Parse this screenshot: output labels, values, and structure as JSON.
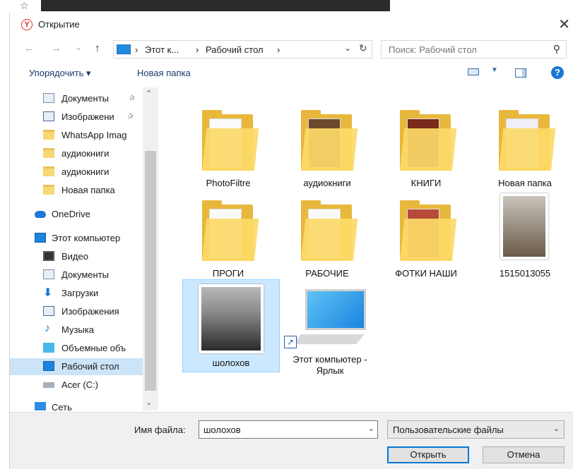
{
  "dialog": {
    "title": "Открытие",
    "close_glyph": "✕"
  },
  "nav": {
    "back_glyph": "←",
    "forward_glyph": "→",
    "recent_glyph": "⌄",
    "up_glyph": "↑",
    "address": {
      "sep": "›",
      "crumbs": [
        "Этот к...",
        "Рабочий стол"
      ],
      "dropdown_glyph": "⌄",
      "refresh_glyph": "↻"
    },
    "search": {
      "placeholder": "Поиск: Рабочий стол",
      "icon_glyph": "⚲"
    }
  },
  "toolbar": {
    "organize_label": "Упорядочить ▾",
    "new_folder_label": "Новая папка",
    "view_dropdown_glyph": "▼",
    "help_glyph": "?"
  },
  "sidebar": {
    "items": [
      {
        "label": "Документы",
        "icon": "documents-icon",
        "pinned": "✰"
      },
      {
        "label": "Изображени",
        "icon": "images-icon",
        "pinned": "✰"
      },
      {
        "label": "WhatsApp Imag",
        "icon": "folder-icon"
      },
      {
        "label": "аудиокниги",
        "icon": "folder-icon"
      },
      {
        "label": "аудиокниги",
        "icon": "folder-icon"
      },
      {
        "label": "Новая папка",
        "icon": "folder-icon"
      },
      {
        "label": "OneDrive",
        "icon": "onedrive-icon"
      },
      {
        "label": "Этот компьютер",
        "icon": "pc-icon"
      },
      {
        "label": "Видео",
        "icon": "video-icon"
      },
      {
        "label": "Документы",
        "icon": "documents-icon"
      },
      {
        "label": "Загрузки",
        "icon": "downloads-icon"
      },
      {
        "label": "Изображения",
        "icon": "images-icon"
      },
      {
        "label": "Музыка",
        "icon": "music-icon"
      },
      {
        "label": "Объемные объ",
        "icon": "3d-objects-icon"
      },
      {
        "label": "Рабочий стол",
        "icon": "desktop-icon",
        "selected": true
      },
      {
        "label": "Acer (C:)",
        "icon": "disk-icon"
      },
      {
        "label": "Сеть",
        "icon": "network-icon"
      }
    ],
    "scroll_up_glyph": "⌃",
    "scroll_down_glyph": "⌄"
  },
  "files": [
    {
      "label": "PhotoFiltre",
      "icon": "folder-icon"
    },
    {
      "label": "аудиокниги",
      "icon": "folder-icon"
    },
    {
      "label": "КНИГИ",
      "icon": "folder-icon"
    },
    {
      "label": "Новая папка",
      "icon": "folder-icon"
    },
    {
      "label": "ПРОГИ",
      "icon": "folder-icon"
    },
    {
      "label": "РАБОЧИЕ",
      "icon": "folder-icon"
    },
    {
      "label": "ФОТКИ НАШИ",
      "icon": "folder-icon"
    },
    {
      "label": "1515013055",
      "icon": "photo-icon"
    },
    {
      "label": "шолохов",
      "icon": "photo-icon",
      "selected": true
    },
    {
      "label": "Этот компьютер - Ярлык",
      "icon": "computer-shortcut-icon"
    }
  ],
  "footer": {
    "filename_label": "Имя файла:",
    "filename_value": "шолохов",
    "filetype_value": "Пользовательские файлы",
    "dropdown_glyph": "⌄",
    "open_label": "Открыть",
    "cancel_label": "Отмена",
    "shortcut_arrow_glyph": "↗"
  },
  "colors": {
    "accent": "#0078d7",
    "selection": "#cce8ff",
    "folder": "#fcd968"
  }
}
